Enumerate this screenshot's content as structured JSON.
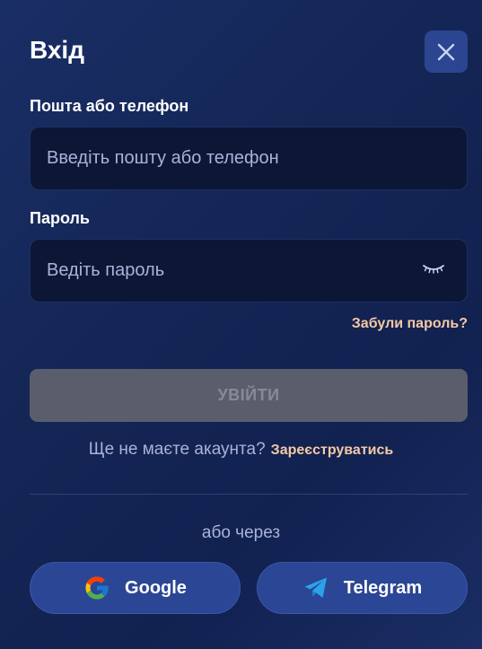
{
  "modal": {
    "title": "Вхід",
    "close_icon": "close-icon"
  },
  "form": {
    "login": {
      "label": "Пошта або телефон",
      "placeholder": "Введіть пошту або телефон",
      "value": ""
    },
    "password": {
      "label": "Пароль",
      "placeholder": "Ведіть пароль",
      "value": "",
      "toggle_icon": "eye-closed-icon"
    },
    "forgot_label": "Забули пароль?",
    "submit_label": "УВІЙТИ",
    "submit_enabled": false
  },
  "register": {
    "question": "Ще не маєте акаунта?",
    "link_label": "Зареєструватись"
  },
  "social": {
    "or_label": "або через",
    "google_label": "Google",
    "telegram_label": "Telegram",
    "google_icon": "google-icon",
    "telegram_icon": "telegram-icon"
  },
  "colors": {
    "background": "#152757",
    "accent_link": "#f5c9a5",
    "input_bg": "#0c1635",
    "button_disabled": "#5a5d6c",
    "social_button": "#2b4694",
    "telegram_blue": "#2aa3e8"
  }
}
